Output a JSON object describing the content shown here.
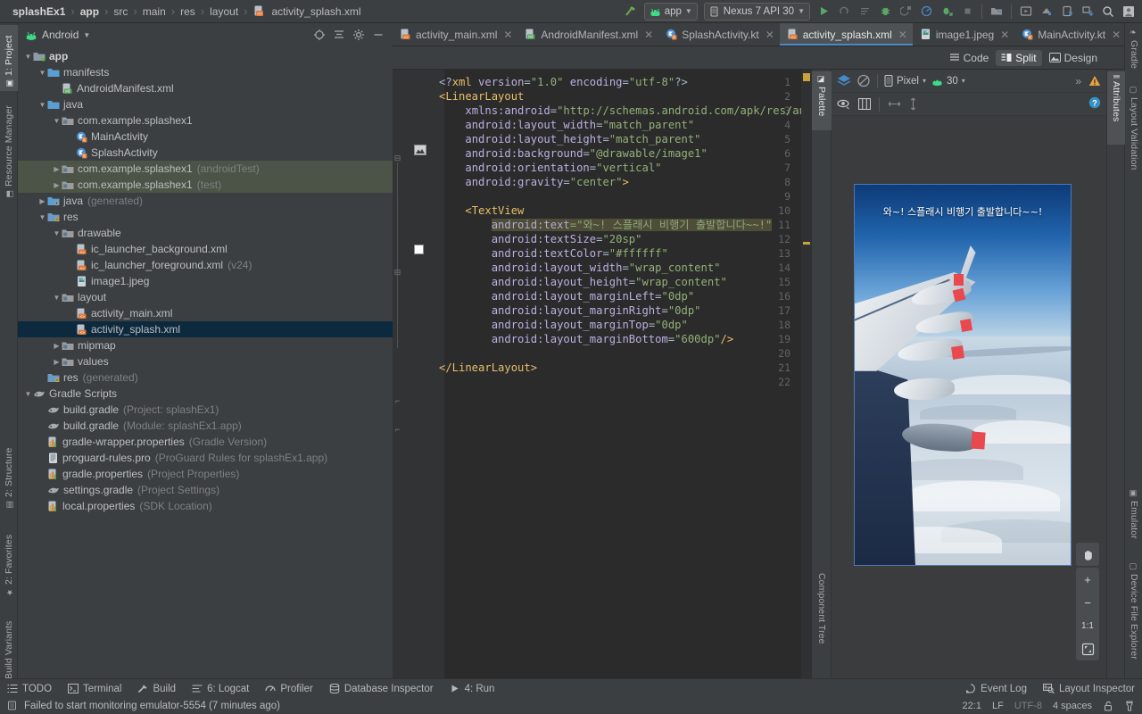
{
  "breadcrumb": {
    "items": [
      "splashEx1",
      "app",
      "src",
      "main",
      "res",
      "layout"
    ],
    "file": "activity_splash.xml"
  },
  "toolbar": {
    "module_label": "app",
    "device_label": "Nexus 7 API 30",
    "run_title": "Run",
    "stop_title": "Stop",
    "search_title": "Search Everywhere"
  },
  "project_panel": {
    "title": "Android",
    "tree": [
      {
        "depth": 0,
        "arrow": "▼",
        "icon": "module-folder",
        "label": "app",
        "bold": true,
        "dim": ""
      },
      {
        "depth": 1,
        "arrow": "▼",
        "icon": "folder",
        "label": "manifests",
        "bold": false,
        "dim": ""
      },
      {
        "depth": 2,
        "arrow": "",
        "icon": "manifest-file",
        "label": "AndroidManifest.xml",
        "bold": false,
        "dim": ""
      },
      {
        "depth": 1,
        "arrow": "▼",
        "icon": "folder",
        "label": "java",
        "bold": false,
        "dim": ""
      },
      {
        "depth": 2,
        "arrow": "▼",
        "icon": "package",
        "label": "com.example.splashex1",
        "bold": false,
        "dim": ""
      },
      {
        "depth": 3,
        "arrow": "",
        "icon": "kotlin-class",
        "label": "MainActivity",
        "bold": false,
        "dim": ""
      },
      {
        "depth": 3,
        "arrow": "",
        "icon": "kotlin-class",
        "label": "SplashActivity",
        "bold": false,
        "dim": ""
      },
      {
        "depth": 2,
        "arrow": "▶",
        "icon": "package",
        "label": "com.example.splashex1",
        "bold": false,
        "dim": "(androidTest)",
        "highlight": "test"
      },
      {
        "depth": 2,
        "arrow": "▶",
        "icon": "package",
        "label": "com.example.splashex1",
        "bold": false,
        "dim": "(test)",
        "highlight": "test"
      },
      {
        "depth": 1,
        "arrow": "▶",
        "icon": "generated-folder",
        "label": "java",
        "bold": false,
        "dim": "(generated)"
      },
      {
        "depth": 1,
        "arrow": "▼",
        "icon": "res-folder",
        "label": "res",
        "bold": false,
        "dim": ""
      },
      {
        "depth": 2,
        "arrow": "▼",
        "icon": "package",
        "label": "drawable",
        "bold": false,
        "dim": ""
      },
      {
        "depth": 3,
        "arrow": "",
        "icon": "xml-file",
        "label": "ic_launcher_background.xml",
        "bold": false,
        "dim": ""
      },
      {
        "depth": 3,
        "arrow": "",
        "icon": "xml-file",
        "label": "ic_launcher_foreground.xml",
        "bold": false,
        "dim": "(v24)"
      },
      {
        "depth": 3,
        "arrow": "",
        "icon": "image-file",
        "label": "image1.jpeg",
        "bold": false,
        "dim": ""
      },
      {
        "depth": 2,
        "arrow": "▼",
        "icon": "package",
        "label": "layout",
        "bold": false,
        "dim": ""
      },
      {
        "depth": 3,
        "arrow": "",
        "icon": "xml-file",
        "label": "activity_main.xml",
        "bold": false,
        "dim": ""
      },
      {
        "depth": 3,
        "arrow": "",
        "icon": "xml-file",
        "label": "activity_splash.xml",
        "bold": false,
        "dim": "",
        "highlight": "selected"
      },
      {
        "depth": 2,
        "arrow": "▶",
        "icon": "package",
        "label": "mipmap",
        "bold": false,
        "dim": ""
      },
      {
        "depth": 2,
        "arrow": "▶",
        "icon": "package",
        "label": "values",
        "bold": false,
        "dim": ""
      },
      {
        "depth": 1,
        "arrow": "",
        "icon": "res-folder",
        "label": "res",
        "bold": false,
        "dim": "(generated)"
      },
      {
        "depth": 0,
        "arrow": "▼",
        "icon": "gradle",
        "label": "Gradle Scripts",
        "bold": false,
        "dim": ""
      },
      {
        "depth": 1,
        "arrow": "",
        "icon": "gradle",
        "label": "build.gradle",
        "bold": false,
        "dim": "(Project: splashEx1)"
      },
      {
        "depth": 1,
        "arrow": "",
        "icon": "gradle",
        "label": "build.gradle",
        "bold": false,
        "dim": "(Module: splashEx1.app)"
      },
      {
        "depth": 1,
        "arrow": "",
        "icon": "properties",
        "label": "gradle-wrapper.properties",
        "bold": false,
        "dim": "(Gradle Version)"
      },
      {
        "depth": 1,
        "arrow": "",
        "icon": "text-file",
        "label": "proguard-rules.pro",
        "bold": false,
        "dim": "(ProGuard Rules for splashEx1.app)"
      },
      {
        "depth": 1,
        "arrow": "",
        "icon": "properties",
        "label": "gradle.properties",
        "bold": false,
        "dim": "(Project Properties)"
      },
      {
        "depth": 1,
        "arrow": "",
        "icon": "gradle",
        "label": "settings.gradle",
        "bold": false,
        "dim": "(Project Settings)"
      },
      {
        "depth": 1,
        "arrow": "",
        "icon": "properties",
        "label": "local.properties",
        "bold": false,
        "dim": "(SDK Location)"
      }
    ]
  },
  "left_strip": [
    {
      "label": "1: Project",
      "icon": "project-icon",
      "active": true
    },
    {
      "label": "Resource Manager",
      "icon": "resource-icon",
      "active": false
    },
    {
      "label": "2: Structure",
      "icon": "structure-icon",
      "active": false
    },
    {
      "label": "2: Favorites",
      "icon": "star-icon",
      "active": false
    },
    {
      "label": "Build Variants",
      "icon": "variants-icon",
      "active": false
    }
  ],
  "right_strip": [
    {
      "label": "Gradle",
      "icon": "gradle-icon"
    },
    {
      "label": "Layout Validation",
      "icon": "layout-validation-icon"
    },
    {
      "label": "Emulator",
      "icon": "emulator-icon"
    },
    {
      "label": "Device File Explorer",
      "icon": "device-file-icon"
    }
  ],
  "editor_tabs": [
    {
      "label": "activity_main.xml",
      "icon": "xml-file",
      "active": false
    },
    {
      "label": "AndroidManifest.xml",
      "icon": "manifest-file",
      "active": false
    },
    {
      "label": "SplashActivity.kt",
      "icon": "kotlin-class",
      "active": false
    },
    {
      "label": "activity_splash.xml",
      "icon": "xml-file",
      "active": true
    },
    {
      "label": "image1.jpeg",
      "icon": "image-file",
      "active": false
    },
    {
      "label": "MainActivity.kt",
      "icon": "kotlin-class",
      "active": false
    }
  ],
  "view_modes": [
    {
      "label": "Code",
      "active": false
    },
    {
      "label": "Split",
      "active": true
    },
    {
      "label": "Design",
      "active": false
    }
  ],
  "code": {
    "line_count": 22,
    "lines": [
      {
        "n": 1,
        "html": "<span class='k-plain'>&lt;?</span><span class='k-decl'>xml </span><span class='k-attr'>version</span><span class='k-plain'>=</span><span class='k-str'>\"1.0\"</span><span class='k-plain'> </span><span class='k-attr'>encoding</span><span class='k-plain'>=</span><span class='k-str'>\"utf-8\"</span><span class='k-plain'>?&gt;</span>"
      },
      {
        "n": 2,
        "html": "<span class='k-tag'>&lt;LinearLayout</span>"
      },
      {
        "n": 3,
        "html": "    <span class='k-ns'>xmlns:android</span><span class='k-plain'>=</span><span class='k-str'>\"http://schemas.android.com/apk/res/android\"</span>"
      },
      {
        "n": 4,
        "html": "    <span class='k-attr'>android:layout_width</span><span class='k-plain'>=</span><span class='k-str'>\"match_parent\"</span>"
      },
      {
        "n": 5,
        "html": "    <span class='k-attr'>android:layout_height</span><span class='k-plain'>=</span><span class='k-str'>\"match_parent\"</span>"
      },
      {
        "n": 6,
        "html": "    <span class='k-attr'>android:background</span><span class='k-plain'>=</span><span class='k-str'>\"@drawable/image1\"</span>"
      },
      {
        "n": 7,
        "html": "    <span class='k-attr'>android:orientation</span><span class='k-plain'>=</span><span class='k-str'>\"vertical\"</span>"
      },
      {
        "n": 8,
        "html": "    <span class='k-attr'>android:gravity</span><span class='k-plain'>=</span><span class='k-str'>\"center\"</span><span class='k-tag'>&gt;</span>"
      },
      {
        "n": 9,
        "html": ""
      },
      {
        "n": 10,
        "html": "    <span class='k-tag'>&lt;TextView</span>"
      },
      {
        "n": 11,
        "html": "        <span class='k-attrh'>android:text</span><span class='k-strh'>=\"와~! 스플래시 비행기 출발합니다~~!\"</span>"
      },
      {
        "n": 12,
        "html": "        <span class='k-attr'>android:textSize</span><span class='k-plain'>=</span><span class='k-str'>\"20sp\"</span>"
      },
      {
        "n": 13,
        "html": "        <span class='k-attr'>android:textColor</span><span class='k-plain'>=</span><span class='k-str'>\"#ffffff\"</span>"
      },
      {
        "n": 14,
        "html": "        <span class='k-attr'>android:layout_width</span><span class='k-plain'>=</span><span class='k-str'>\"wrap_content\"</span>"
      },
      {
        "n": 15,
        "html": "        <span class='k-attr'>android:layout_height</span><span class='k-plain'>=</span><span class='k-str'>\"wrap_content\"</span>"
      },
      {
        "n": 16,
        "html": "        <span class='k-attr'>android:layout_marginLeft</span><span class='k-plain'>=</span><span class='k-str'>\"0dp\"</span>"
      },
      {
        "n": 17,
        "html": "        <span class='k-attr'>android:layout_marginRight</span><span class='k-plain'>=</span><span class='k-str'>\"0dp\"</span>"
      },
      {
        "n": 18,
        "html": "        <span class='k-attr'>android:layout_marginTop</span><span class='k-plain'>=</span><span class='k-str'>\"0dp\"</span>"
      },
      {
        "n": 19,
        "html": "        <span class='k-attr'>android:layout_marginBottom</span><span class='k-plain'>=</span><span class='k-str'>\"600dp\"</span><span class='k-tag'>/&gt;</span>"
      },
      {
        "n": 20,
        "html": ""
      },
      {
        "n": 21,
        "html": "<span class='k-tag'>&lt;/LinearLayout&gt;</span>"
      },
      {
        "n": 22,
        "html": ""
      }
    ]
  },
  "design": {
    "palette_label": "Palette",
    "component_tree_label": "Component Tree",
    "attributes_label": "Attributes",
    "device_name": "Pixel",
    "api_level": "30",
    "overflow_label": "»",
    "preview_text": "와~! 스플래시 비행기 출발합니다~~!",
    "zoom_controls": [
      {
        "name": "pan-tool",
        "glyph": "✋"
      },
      {
        "name": "zoom-in",
        "glyph": "+"
      },
      {
        "name": "zoom-out",
        "glyph": "−"
      },
      {
        "name": "zoom-actual",
        "glyph": "1:1"
      },
      {
        "name": "zoom-fit",
        "glyph": "⛶"
      }
    ]
  },
  "bottom_bar": {
    "items": [
      {
        "label": "TODO",
        "icon": "todo-icon"
      },
      {
        "label": "Terminal",
        "icon": "terminal-icon"
      },
      {
        "label": "Build",
        "icon": "build-icon"
      },
      {
        "label": "6: Logcat",
        "icon": "logcat-icon"
      },
      {
        "label": "Profiler",
        "icon": "profiler-icon"
      },
      {
        "label": "Database Inspector",
        "icon": "database-icon"
      },
      {
        "label": "4: Run",
        "icon": "run-icon"
      }
    ],
    "right": [
      {
        "label": "Event Log",
        "icon": "event-log-icon"
      },
      {
        "label": "Layout Inspector",
        "icon": "layout-inspector-icon"
      }
    ]
  },
  "status_bar": {
    "message": "Failed to start monitoring emulator-5554 (7 minutes ago)",
    "caret": "22:1",
    "line_sep": "LF",
    "encoding": "UTF-8",
    "indent": "4 spaces",
    "lock_icon": "unlocked-icon",
    "inspection_icon": "inspection-icon"
  },
  "colors": {
    "accent": "#4a88c7",
    "selection": "#0d293e",
    "test_highlight": "#4b5446",
    "warning": "#e8a33d",
    "editor_bg": "#2b2b2b",
    "panel_bg": "#3c3f41"
  }
}
